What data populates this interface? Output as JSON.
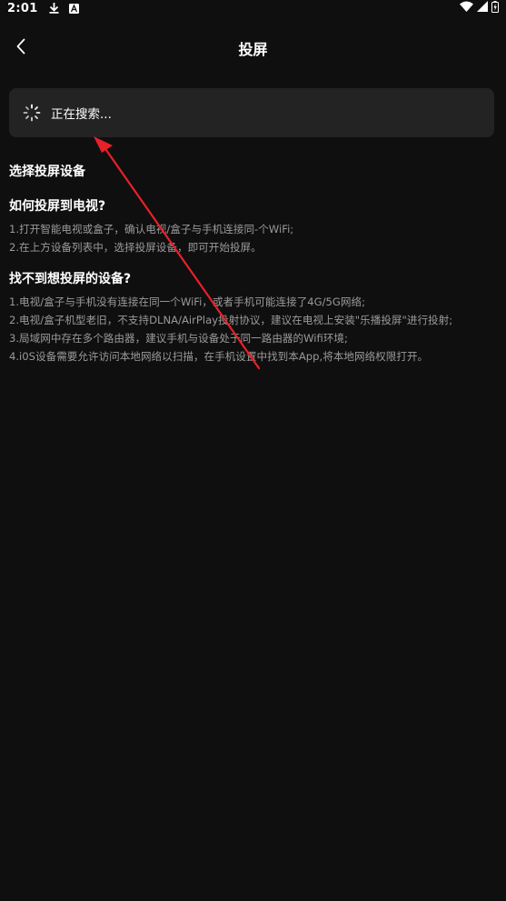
{
  "status_bar": {
    "time": "2:01",
    "left_icons": [
      "download-icon",
      "font-a-icon"
    ],
    "right_icons": [
      "wifi-icon",
      "signal-icon",
      "battery-icon"
    ]
  },
  "header": {
    "back_icon": "chevron-left-icon",
    "title": "投屏"
  },
  "search": {
    "status_text": "正在搜索...",
    "icon": "loading-spinner-icon"
  },
  "devices": {
    "section_title": "选择投屏设备"
  },
  "help": [
    {
      "title": "如何投屏到电视?",
      "lines": [
        "1.打开智能电视或盒子，确认电视/盒子与手机连接同-个WiFi;",
        "2.在上方设备列表中，选择投屏设备，即可开始投屏。"
      ]
    },
    {
      "title": "找不到想投屏的设备?",
      "lines": [
        "1.电视/盒子与手机没有连接在同一个WiFi，或者手机可能连接了4G/5G网络;",
        "2.电视/盒子机型老旧，不支持DLNA/AirPlay投射协议，建议在电视上安装\"乐播投屏\"进行投射;",
        "3.局域网中存在多个路由器，建议手机与设备处于同一路由器的Wifi环境;",
        "4.i0S设备需要允许访问本地网络以扫描，在手机设置中找到本App,将本地网络权限打开。"
      ]
    }
  ],
  "colors": {
    "background": "#0f0f0f",
    "card": "#232323",
    "text_primary": "#ffffff",
    "text_secondary": "#9a9a9a",
    "annotation_arrow": "#e8202a"
  }
}
